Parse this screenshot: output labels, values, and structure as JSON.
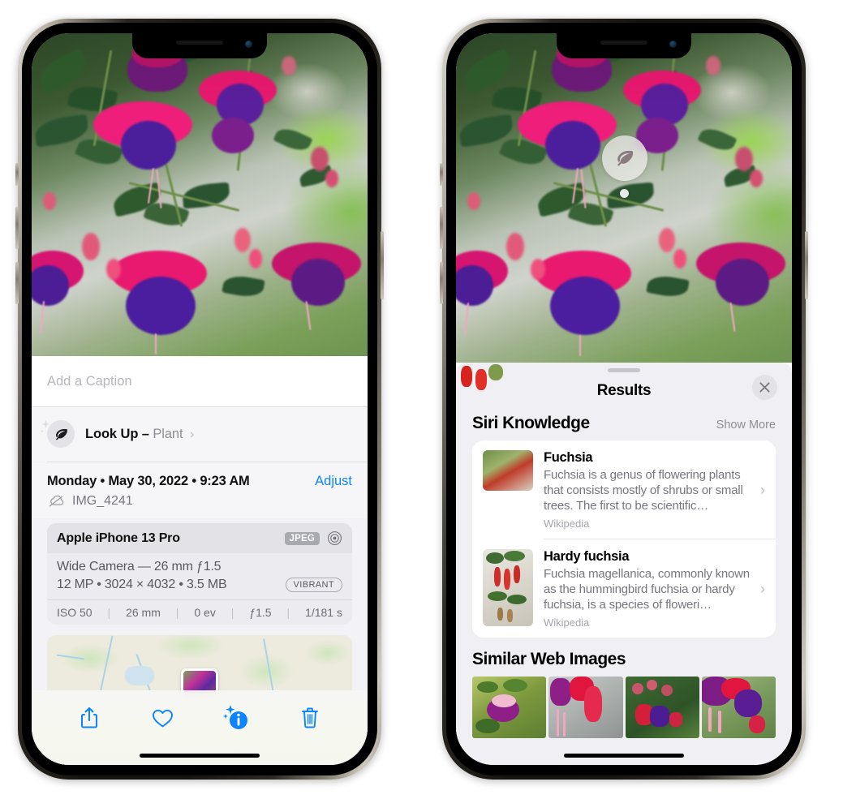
{
  "left_phone": {
    "name": "photos-detail-screen",
    "caption_placeholder": "Add a Caption",
    "lookup": {
      "label": "Look Up",
      "dash": "–",
      "subject": "Plant",
      "chevron": "›",
      "icon": "leaf-icon"
    },
    "meta": {
      "date": "Monday • May 30, 2022 • 9:23 AM",
      "adjust_label": "Adjust",
      "filename": "IMG_4241",
      "cloud_icon": "cloud-slash-icon"
    },
    "camera": {
      "device": "Apple iPhone 13 Pro",
      "format_tag": "JPEG",
      "lens_icon": "aperture-icon",
      "lens_line": "Wide Camera — 26 mm ƒ1.5",
      "details_line": "12 MP • 3024 × 4032 • 3.5 MB",
      "style_tag": "VIBRANT",
      "exif": [
        "ISO 50",
        "26 mm",
        "0 ev",
        "ƒ1.5",
        "1/181 s"
      ],
      "exif_divider": "|"
    },
    "toolbar": [
      {
        "name": "share-button",
        "icon": "share-icon"
      },
      {
        "name": "favorite-button",
        "icon": "heart-icon"
      },
      {
        "name": "info-button",
        "icon": "info-sparkle-icon"
      },
      {
        "name": "delete-button",
        "icon": "trash-icon"
      }
    ],
    "map": {
      "name": "location-map",
      "pin": "photo-pin"
    }
  },
  "right_phone": {
    "name": "visual-lookup-results-screen",
    "marker_icon": "leaf-icon",
    "sheet": {
      "title": "Results",
      "close_icon": "close-icon",
      "grabber": "drag-handle"
    },
    "siri_knowledge": {
      "heading": "Siri Knowledge",
      "show_more": "Show More",
      "items": [
        {
          "title": "Fuchsia",
          "description": "Fuchsia is a genus of flowering plants that consists mostly of shrubs or small trees. The first to be scientific…",
          "source": "Wikipedia",
          "chevron": "›"
        },
        {
          "title": "Hardy fuchsia",
          "description": "Fuchsia magellanica, commonly known as the hummingbird fuchsia or hardy fuchsia, is a species of floweri…",
          "source": "Wikipedia",
          "chevron": "›"
        }
      ]
    },
    "similar_web_images": {
      "heading": "Similar Web Images",
      "count": 4
    }
  },
  "colors": {
    "accent_blue": "#0a84ff",
    "sheet_bg": "#f0f0f4",
    "card_bg": "#ffffff",
    "secondary_text": "#8d8d93",
    "tag_gray": "#a9a9b0"
  }
}
